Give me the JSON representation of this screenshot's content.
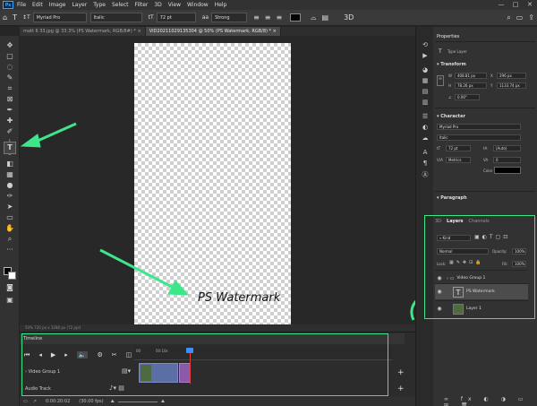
{
  "app": {
    "logo": "Ps"
  },
  "menu": [
    "File",
    "Edit",
    "Image",
    "Layer",
    "Type",
    "Select",
    "Filter",
    "3D",
    "View",
    "Window",
    "Help"
  ],
  "window_controls": [
    "—",
    "□",
    "✕"
  ],
  "options_bar": {
    "tool_glyph": "T",
    "font_family": "Myriad Pro",
    "font_style": "Italic",
    "font_size": "72 pt",
    "anti_alias": "Strong"
  },
  "tabs": [
    {
      "label": "matt 6 33.jpg @ 33.3% (PS Watermark, RGB/8#) *"
    },
    {
      "label": "VID20211029135304 @ 50% (PS Watermark, RGB/8) *",
      "active": true
    }
  ],
  "canvas": {
    "watermark_text": "PS Watermark"
  },
  "statusbar": {
    "text": "50%     720 px x 1280 px (72 ppi)"
  },
  "timeline": {
    "title": "Timeline",
    "ruler_labels": [
      "00",
      "00:10s"
    ],
    "video_group": "Video Group 1",
    "audio_track": "Audio Track",
    "timecode": "0:00:20:02",
    "fps": "(30.00 fps)"
  },
  "properties": {
    "tab": "Properties",
    "type_layer_label": "Type Layer",
    "transform_title": "Transform",
    "w_label": "W",
    "w_value": "408.81 px",
    "h_label": "H",
    "h_value": "78.26 px",
    "x_label": "X",
    "x_value": "296 px",
    "y_label": "Y",
    "y_value": "1133.74 px",
    "angle_value": "0.00°",
    "character_title": "Character",
    "font": "Myriad Pro",
    "style": "Italic",
    "size": "72 pt",
    "leading": "(Auto)",
    "kerning": "Metrics",
    "tracking": "0",
    "color_label": "Color",
    "paragraph_title": "Paragraph"
  },
  "layers_panel": {
    "tabs": [
      "3D",
      "Layers",
      "Channels"
    ],
    "kind_label": "Kind",
    "blend_mode": "Normal",
    "opacity_label": "Opacity:",
    "opacity": "100%",
    "lock_label": "Lock:",
    "fill_label": "Fill:",
    "fill": "100%",
    "layers": [
      {
        "name": "Video Group 1",
        "type": "group"
      },
      {
        "name": "PS Watermark",
        "type": "text",
        "selected": true
      },
      {
        "name": "Layer 1",
        "type": "image"
      }
    ]
  },
  "colors": {
    "annotation_green": "#3ee68a",
    "ps_blue": "#31a8ff",
    "clip_video": "#5b6fa6",
    "clip_text": "#8a5aa8"
  }
}
